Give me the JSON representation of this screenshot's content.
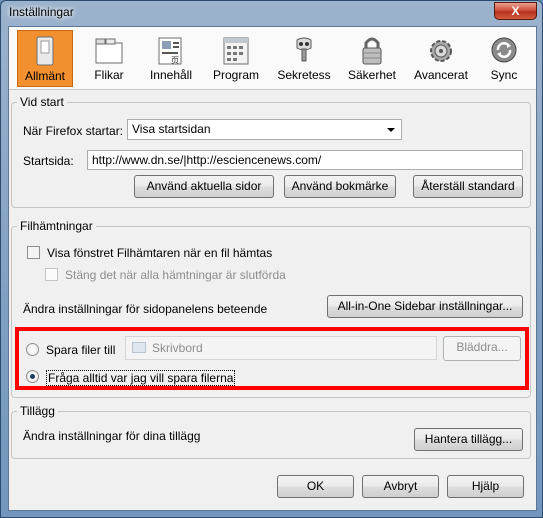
{
  "window": {
    "title": "Inställningar",
    "close_label": "X"
  },
  "panes": [
    {
      "label": "Allmänt",
      "icon": "switch-icon",
      "selected": true
    },
    {
      "label": "Flikar",
      "icon": "tabs-icon"
    },
    {
      "label": "Innehåll",
      "icon": "content-icon"
    },
    {
      "label": "Program",
      "icon": "applications-icon"
    },
    {
      "label": "Sekretess",
      "icon": "privacy-mask-icon"
    },
    {
      "label": "Säkerhet",
      "icon": "padlock-icon"
    },
    {
      "label": "Avancerat",
      "icon": "gear-icon"
    },
    {
      "label": "Sync",
      "icon": "sync-icon"
    }
  ],
  "startup": {
    "legend": "Vid start",
    "when_label": "När Firefox startar:",
    "when_value": "Visa startsidan",
    "homepage_label": "Startsida:",
    "homepage_value": "http://www.dn.se/|http://esciencenews.com/",
    "use_current": "Använd aktuella sidor",
    "use_bookmark": "Använd bokmärke",
    "restore_default": "Återställ standard"
  },
  "downloads": {
    "legend": "Filhämtningar",
    "show_window": "Visa fönstret Filhämtaren när en fil hämtas",
    "close_when_done": "Stäng det när alla hämtningar är slutförda",
    "sidebar_text": "Ändra inställningar för sidopanelens beteende",
    "sidebar_button": "All-in-One Sidebar inställningar...",
    "save_to": "Spara filer till",
    "folder": "Skrivbord",
    "browse": "Bläddra...",
    "always_ask": "Fråga alltid var jag vill spara filerna"
  },
  "addons": {
    "legend": "Tillägg",
    "text": "Ändra inställningar för dina tillägg",
    "manage": "Hantera tillägg..."
  },
  "footer": {
    "ok": "OK",
    "cancel": "Avbryt",
    "help": "Hjälp"
  },
  "colors": {
    "selected_pane": "#f28f2e",
    "highlight_box": "#ff0000"
  }
}
